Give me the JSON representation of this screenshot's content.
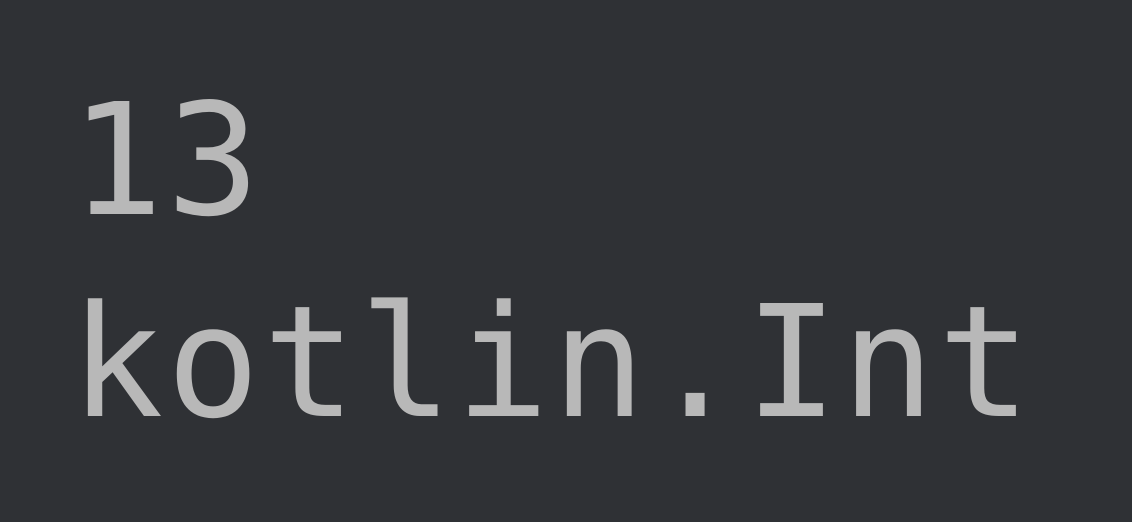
{
  "output": {
    "line1": "13",
    "line2": "kotlin.Int"
  }
}
